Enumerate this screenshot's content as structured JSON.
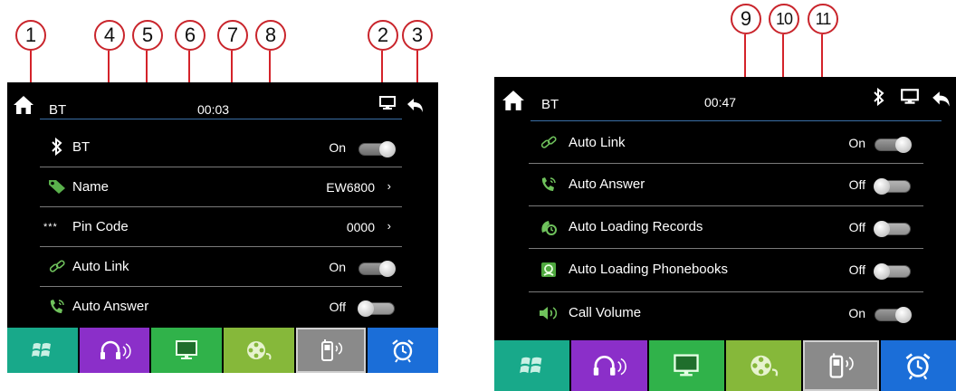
{
  "callouts": [
    "1",
    "2",
    "3",
    "4",
    "5",
    "6",
    "7",
    "8",
    "9",
    "10",
    "11"
  ],
  "left": {
    "title": "BT",
    "time": "00:03",
    "rows": [
      {
        "label": "BT",
        "value": "On",
        "control": "toggle-on"
      },
      {
        "label": "Name",
        "value": "EW6800",
        "control": "arrow"
      },
      {
        "label": "Pin Code",
        "value": "0000",
        "control": "arrow"
      },
      {
        "label": "Auto Link",
        "value": "On",
        "control": "toggle-on"
      },
      {
        "label": "Auto Answer",
        "value": "Off",
        "control": "toggle-off"
      }
    ]
  },
  "right": {
    "title": "BT",
    "time": "00:47",
    "rows": [
      {
        "label": "Auto Link",
        "value": "On",
        "control": "toggle-on"
      },
      {
        "label": "Auto Answer",
        "value": "Off",
        "control": "toggle-off"
      },
      {
        "label": "Auto Loading Records",
        "value": "Off",
        "control": "toggle-off"
      },
      {
        "label": "Auto Loading Phonebooks",
        "value": "Off",
        "control": "toggle-off"
      },
      {
        "label": "Call Volume",
        "value": "On",
        "control": "toggle-on"
      }
    ]
  },
  "chevron": "›",
  "pin_icon_text": "***",
  "dock": [
    {
      "name": "windows-icon",
      "color": "#18a98a"
    },
    {
      "name": "headphones-icon",
      "color": "#8b2fc9"
    },
    {
      "name": "monitor-icon",
      "color": "#30b24a"
    },
    {
      "name": "film-reel-icon",
      "color": "#86b83a"
    },
    {
      "name": "phone-bluetooth-icon",
      "color": "#8a8a8a"
    },
    {
      "name": "alarm-clock-icon",
      "color": "#1b6ed8"
    }
  ],
  "colors": {
    "callout_border": "#c9252c",
    "leader": "#d4232a",
    "accent_line": "#3a6ea5"
  }
}
